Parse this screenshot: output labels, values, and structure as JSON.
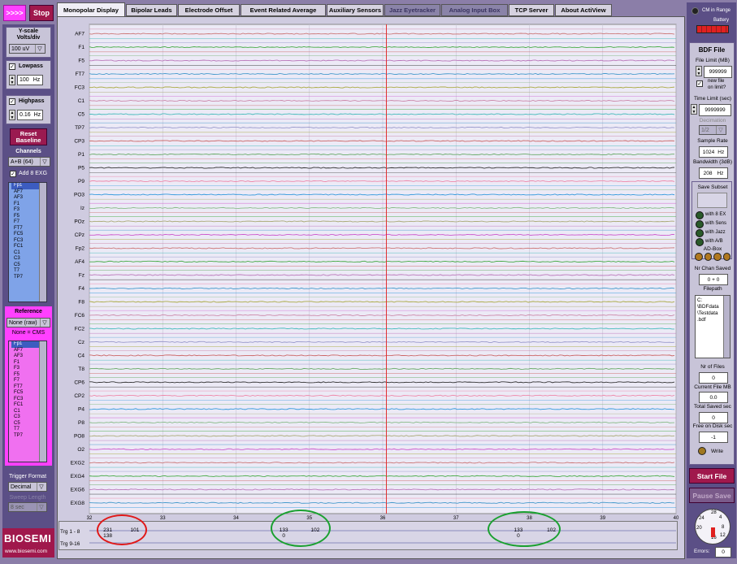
{
  "top": {
    "start_label": ">>>>",
    "stop_label": "Stop"
  },
  "tabs": [
    {
      "label": "Monopolar Display",
      "active": true
    },
    {
      "label": "Bipolar Leads"
    },
    {
      "label": "Electrode Offset"
    },
    {
      "label": "Event Related Average"
    },
    {
      "label": "Auxiliary Sensors"
    },
    {
      "label": "Jazz Eyetracker"
    },
    {
      "label": "Analog Input Box"
    },
    {
      "label": "TCP Server"
    },
    {
      "label": "About ActiView"
    }
  ],
  "left": {
    "yscale_title": "Y-scale",
    "yscale_sub": "Volts/div",
    "yscale_value": "100 uV",
    "lowpass_label": "Lowpass",
    "lowpass_value": "100",
    "lowpass_unit": "Hz",
    "highpass_label": "Highpass",
    "highpass_value": "0.16",
    "highpass_unit": "Hz",
    "reset_label_1": "Reset",
    "reset_label_2": "Baseline",
    "channels_label": "Channels",
    "channels_value": "A+B (64)",
    "add_exg_label": "Add 8 EXG",
    "channel_list": [
      "Fp1",
      "AF7",
      "AF3",
      "F1",
      "F3",
      "F5",
      "F7",
      "FT7",
      "FC5",
      "FC3",
      "FC1",
      "C1",
      "C3",
      "C5",
      "T7",
      "TP7"
    ],
    "reference_label": "Reference",
    "reference_value": "None (raw)",
    "reference_note": "None = CMS",
    "reference_list": [
      "Fp1",
      "AF7",
      "AF3",
      "F1",
      "F3",
      "F5",
      "F7",
      "FT7",
      "FC5",
      "FC3",
      "FC1",
      "C1",
      "C3",
      "C5",
      "T7",
      "TP7"
    ],
    "trigger_format_label": "Trigger Format",
    "trigger_format_value": "Decimal",
    "sweep_label": "Sweep Length",
    "sweep_value": "8 sec",
    "logo_text": "BIOSEMI",
    "logo_url": "www.biosemi.com"
  },
  "plot": {
    "channels": [
      "AF7",
      "F1",
      "F5",
      "FT7",
      "FC3",
      "C1",
      "C5",
      "TP7",
      "CP3",
      "P1",
      "P5",
      "P9",
      "PO3",
      "Iz",
      "POz",
      "CPz",
      "Fp2",
      "AF4",
      "Fz",
      "F4",
      "F8",
      "FC6",
      "FC2",
      "Cz",
      "C4",
      "T8",
      "CP6",
      "CP2",
      "P4",
      "P8",
      "PO8",
      "O2",
      "EXG2",
      "EXG4",
      "EXG6",
      "EXG8"
    ],
    "time_ticks": [
      "32",
      "33",
      "34",
      "35",
      "36",
      "37",
      "38",
      "39",
      "40"
    ],
    "cursor_time": 36.05
  },
  "colors": {
    "trace_colors": [
      "#c77",
      "#4a4",
      "#b7b",
      "#49c",
      "#aa4",
      "#c8a",
      "#4bb",
      "#99c",
      "#c66",
      "#6a6",
      "#333",
      "#e8a",
      "#39d",
      "#8b8",
      "#aa7",
      "#c5c"
    ]
  },
  "triggers": {
    "row1_label": "Trg 1 - 8",
    "row2_label": "Trg 9-16",
    "events": [
      {
        "time": 32.25,
        "top": "231",
        "bottom": "138"
      },
      {
        "time": 32.62,
        "top": "101",
        "bottom": ""
      },
      {
        "time": 34.65,
        "top": "133",
        "bottom": "0"
      },
      {
        "time": 35.08,
        "top": "102",
        "bottom": ""
      },
      {
        "time": 37.85,
        "top": "133",
        "bottom": "0"
      },
      {
        "time": 38.3,
        "top": "102",
        "bottom": ""
      }
    ]
  },
  "right": {
    "cm_label": "CM in Range",
    "battery_label": "Battery",
    "bdf_title": "BDF File",
    "file_limit_label": "File Limit (MB)",
    "file_limit_value": "999999",
    "new_file_label_1": "new file",
    "new_file_label_2": "on limit?",
    "time_limit_label": "Time Limit (sec)",
    "time_limit_value": "9999999",
    "decimation_label": "Decimation",
    "decimation_value": "1/2",
    "sample_rate_label": "Sample Rate",
    "sample_rate_value": "1024",
    "sample_rate_unit": "Hz",
    "bandwidth_label": "Bandwidth (3dB)",
    "bandwidth_value": "208",
    "bandwidth_unit": "Hz",
    "save_subset_label": "Save Subset",
    "with_8ex": "with 8 EX",
    "with_sens": "with Sens",
    "with_jazz": "with Jazz",
    "with_ab": "with A/B",
    "adbox_label": "AD-Box",
    "nr_chan_label": "Nr Chan Saved",
    "nr_chan_value": "0 + 0",
    "filepath_label": "Filepath",
    "filepath_lines": [
      "C:",
      "\\BDFdata",
      "\\Testdata",
      ".bdf"
    ],
    "nr_files_label": "Nr of Files",
    "nr_files_value": "0",
    "current_mb_label": "Current File MB",
    "current_mb_value": "0.0",
    "total_saved_label": "Total Saved sec",
    "total_saved_value": "0",
    "free_disk_label": "Free on Disk sec",
    "free_disk_value": "-1",
    "write_label": "Write",
    "start_file_label": "Start File",
    "pause_save_label": "Pause Save",
    "errors_label": "Errors:",
    "errors_value": "0",
    "dial_ticks": [
      "28",
      "4",
      "24",
      "8",
      "20",
      "12",
      "16"
    ]
  }
}
